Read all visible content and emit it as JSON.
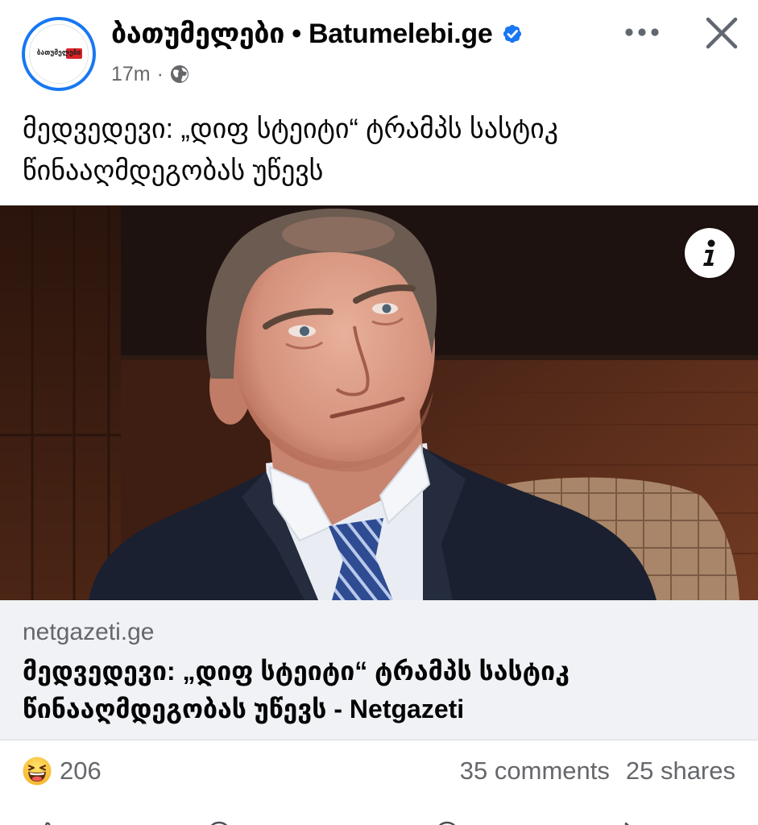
{
  "post": {
    "page_name": "ბათუმელები • Batumelebi.ge",
    "avatar_logo_text": "ბათუმელები",
    "verified_icon": "verified-badge-icon",
    "timestamp": "17m",
    "meta_separator": "·",
    "audience_icon": "globe-icon",
    "more_icon": "more-horizontal-icon",
    "close_icon": "close-icon",
    "text_lines": [
      "მედვედევი: „დიფ სტეიტი“ ტრამპს სასტიკ",
      "წინააღმდეგობას უწევს"
    ]
  },
  "link_preview": {
    "info_icon": "info-icon",
    "domain": "netgazeti.ge",
    "title_lines": [
      "მედვედევი: „დიფ სტეიტი“ ტრამპს სასტიკ",
      "წინააღმდეგობას უწევს - Netgazeti"
    ]
  },
  "engagement": {
    "reaction_icon": "haha-reaction-icon",
    "reaction_count": "206",
    "comments": "35 comments",
    "shares": "25 shares"
  },
  "action_bar": {
    "icons": [
      "like-icon",
      "comment-icon",
      "send-icon",
      "share-icon"
    ]
  },
  "colors": {
    "accent": "#1877f2",
    "text_primary": "#050505",
    "text_secondary": "#65676b",
    "preview_background": "#f0f2f5"
  }
}
